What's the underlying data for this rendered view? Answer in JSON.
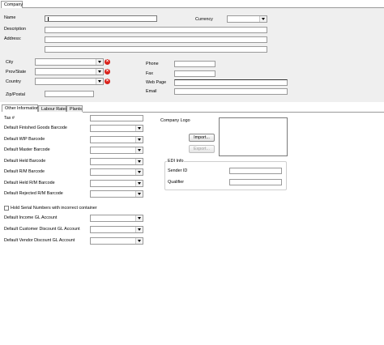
{
  "tabs_top": {
    "company": "Company"
  },
  "company": {
    "name_label": "Name",
    "name_value": "",
    "currency_label": "Currency",
    "currency_value": "",
    "description_label": "Description",
    "address_label": "Address:",
    "city_label": "City",
    "prov_label": "Prov/State",
    "country_label": "Country",
    "zip_label": "Zip/Postal",
    "phone_label": "Phone",
    "fax_label": "Fax",
    "webpage_label": "Web Page",
    "email_label": "Email"
  },
  "tabs_lower": {
    "other": "Other Information",
    "labour": "Labour Rates",
    "plants": "Plants"
  },
  "other": {
    "tax_label": "Tax #",
    "fields": [
      "Default Finished Goods Barcode",
      "Default WIP Barcode",
      "Default Master Barcode",
      "Default Held Barcode",
      "Default R/M Barcode",
      "Default Held R/M Barcode",
      "Default Rejected R/M Barcode"
    ],
    "hold_serial_label": "Hold Serial Numbers with incorrect container",
    "hold_serial_checked": false,
    "gl_fields": [
      "Default Income GL Account",
      "Default Customer Discount GL Account",
      "Default Vendor Discount GL Account"
    ],
    "logo_label": "Company Logo",
    "import_label": "Import...",
    "export_label": "Export...",
    "edi_title": "EDI Info",
    "sender_label": "Sender ID",
    "qualifier_label": "Qualifier"
  },
  "colors": {
    "panel_bg": "#efefef",
    "delete_red": "#d9221b",
    "border": "#9a9a9a"
  },
  "icons": {
    "delete": "delete-x-icon",
    "dropdown": "chevron-down-icon"
  }
}
